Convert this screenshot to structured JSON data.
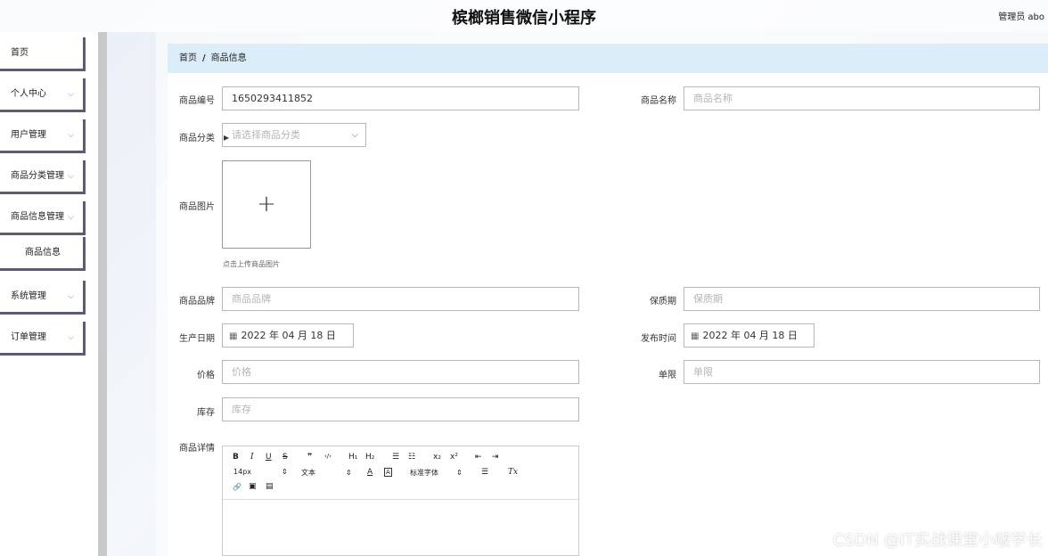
{
  "header": {
    "title": "槟榔销售微信小程序",
    "user": "管理员 abo"
  },
  "sidebar": {
    "items": [
      {
        "label": "首页",
        "has_chevron": false
      },
      {
        "label": "个人中心",
        "has_chevron": true
      },
      {
        "label": "用户管理",
        "has_chevron": true
      },
      {
        "label": "商品分类管理",
        "has_chevron": true
      },
      {
        "label": "商品信息管理",
        "has_chevron": true
      },
      {
        "label": "商品信息",
        "has_chevron": false
      },
      {
        "label": "系统管理",
        "has_chevron": true
      },
      {
        "label": "订单管理",
        "has_chevron": true
      }
    ],
    "chevron": "⌵"
  },
  "breadcrumb": {
    "home": "首页",
    "separator": "/",
    "current": "商品信息"
  },
  "form": {
    "product_code": {
      "label": "商品编号",
      "value": "1650293411852"
    },
    "product_name": {
      "label": "商品名称",
      "placeholder": "商品名称"
    },
    "product_category": {
      "label": "商品分类",
      "placeholder": "请选择商品分类"
    },
    "product_image": {
      "label": "商品图片",
      "plus": "+",
      "hint": "点击上传商品图片"
    },
    "product_brand": {
      "label": "商品品牌",
      "placeholder": "商品品牌"
    },
    "shelf_life": {
      "label": "保质期",
      "placeholder": "保质期"
    },
    "production_date": {
      "label": "生产日期",
      "value": "2022 年 04 月 18 日"
    },
    "release_time": {
      "label": "发布时间",
      "value": "2022 年 04 月 18 日"
    },
    "price": {
      "label": "价格",
      "placeholder": "价格"
    },
    "limit": {
      "label": "单限",
      "placeholder": "单限"
    },
    "stock": {
      "label": "库存",
      "placeholder": "库存"
    },
    "details": {
      "label": "商品详情"
    }
  },
  "editor": {
    "bold": "B",
    "italic": "I",
    "underline": "U",
    "strike": "S",
    "quote": "❞",
    "code": "‹/›",
    "h1": "H₁",
    "h2": "H₂",
    "ordered_list": "☰",
    "bullet_list": "☷",
    "subscript": "x₂",
    "superscript": "x²",
    "outdent": "⇤",
    "indent": "⇥",
    "font_size": "14px",
    "text_type": "文本",
    "font_family": "标准字体",
    "font_color": "A",
    "bg_color": "A",
    "align": "☰",
    "clear": "Tx",
    "link": "🔗",
    "image": "▣",
    "video": "▤"
  },
  "icons": {
    "calendar": "▦",
    "caret_down": "⌵",
    "updown": "⇕"
  },
  "watermark": "CSDN @IT实战课堂小啵学长"
}
